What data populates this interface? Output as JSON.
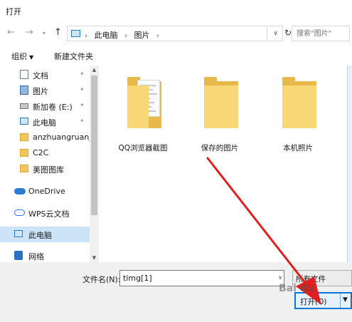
{
  "window": {
    "title": "打开"
  },
  "address": {
    "crumbs": [
      "此电脑",
      "图片"
    ],
    "search_placeholder": "搜索\"图片\""
  },
  "toolbar": {
    "organize_label": "组织",
    "new_folder_label": "新建文件夹"
  },
  "navpane": {
    "items": [
      {
        "label": "文档",
        "icon": "document-icon",
        "pinned": true
      },
      {
        "label": "图片",
        "icon": "pictures-icon",
        "pinned": true
      },
      {
        "label": "新加卷 (E:)",
        "icon": "drive-icon",
        "pinned": true
      },
      {
        "label": "此电脑",
        "icon": "computer-icon",
        "pinned": true
      },
      {
        "label": "anzhuangruanj",
        "icon": "folder-icon",
        "pinned": false
      },
      {
        "label": "C2C",
        "icon": "folder-icon",
        "pinned": false
      },
      {
        "label": "美图图库",
        "icon": "folder-icon",
        "pinned": false
      },
      {
        "label": "OneDrive",
        "icon": "onedrive-icon",
        "pinned": false
      },
      {
        "label": "WPS云文档",
        "icon": "wps-cloud-icon",
        "pinned": false
      },
      {
        "label": "此电脑",
        "icon": "computer-icon",
        "pinned": false,
        "selected": true
      },
      {
        "label": "网络",
        "icon": "network-icon",
        "pinned": false
      }
    ]
  },
  "folders": [
    {
      "name": "QQ浏览器截图",
      "has_content": true
    },
    {
      "name": "保存的图片",
      "has_content": false
    },
    {
      "name": "本机照片",
      "has_content": false
    }
  ],
  "footer": {
    "filename_label": "文件名(N):",
    "filename_value": "timg[1]",
    "filetype_value": "所有文件",
    "open_label": "打开(O)"
  },
  "annotation": {
    "watermark_text": "Bai du"
  },
  "colors": {
    "accent": "#0078d7",
    "selection": "#cce4f7",
    "folder_front": "#f8d777",
    "folder_back": "#e9b84b",
    "arrow": "#e02020"
  }
}
